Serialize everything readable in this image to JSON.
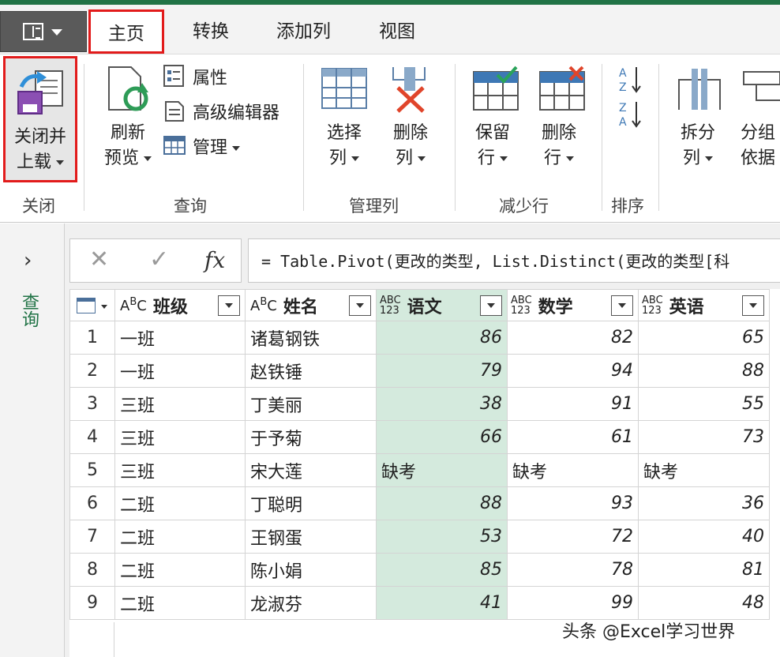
{
  "tabs": {
    "home": "主页",
    "transform": "转换",
    "add_column": "添加列",
    "view": "视图"
  },
  "ribbon": {
    "close": {
      "btn_line1": "关闭并",
      "btn_line2": "上载",
      "group": "关闭"
    },
    "query": {
      "refresh_line1": "刷新",
      "refresh_line2": "预览",
      "properties": "属性",
      "advanced_editor": "高级编辑器",
      "manage": "管理",
      "group": "查询"
    },
    "manage_columns": {
      "choose_line1": "选择",
      "choose_line2": "列",
      "remove_line1": "删除",
      "remove_line2": "列",
      "group": "管理列"
    },
    "reduce_rows": {
      "keep_line1": "保留",
      "keep_line2": "行",
      "remove_line1": "删除",
      "remove_line2": "行",
      "group": "减少行"
    },
    "sort": {
      "group": "排序"
    },
    "split": {
      "line1": "拆分",
      "line2": "列"
    },
    "group_by": {
      "line1": "分组",
      "line2": "依据"
    }
  },
  "side_pane": {
    "label": "查询"
  },
  "formula": {
    "text": "= Table.Pivot(更改的类型, List.Distinct(更改的类型[科"
  },
  "table": {
    "columns": [
      {
        "type": "ABC",
        "name": "班级"
      },
      {
        "type": "ABC",
        "name": "姓名"
      },
      {
        "type": "ABC123",
        "name": "语文"
      },
      {
        "type": "ABC123",
        "name": "数学"
      },
      {
        "type": "ABC123",
        "name": "英语"
      }
    ],
    "rows": [
      {
        "n": "1",
        "class": "一班",
        "name": "诸葛钢铁",
        "chinese": "86",
        "math": "82",
        "english": "65"
      },
      {
        "n": "2",
        "class": "一班",
        "name": "赵铁锤",
        "chinese": "79",
        "math": "94",
        "english": "88"
      },
      {
        "n": "3",
        "class": "三班",
        "name": "丁美丽",
        "chinese": "38",
        "math": "91",
        "english": "55"
      },
      {
        "n": "4",
        "class": "三班",
        "name": "于予菊",
        "chinese": "66",
        "math": "61",
        "english": "73"
      },
      {
        "n": "5",
        "class": "三班",
        "name": "宋大莲",
        "chinese": "缺考",
        "math": "缺考",
        "english": "缺考"
      },
      {
        "n": "6",
        "class": "二班",
        "name": "丁聪明",
        "chinese": "88",
        "math": "93",
        "english": "36"
      },
      {
        "n": "7",
        "class": "二班",
        "name": "王钢蛋",
        "chinese": "53",
        "math": "72",
        "english": "40"
      },
      {
        "n": "8",
        "class": "二班",
        "name": "陈小娟",
        "chinese": "85",
        "math": "78",
        "english": "81"
      },
      {
        "n": "9",
        "class": "二班",
        "name": "龙淑芬",
        "chinese": "41",
        "math": "99",
        "english": "48"
      }
    ]
  },
  "watermark": "头条 @Excel学习世界"
}
